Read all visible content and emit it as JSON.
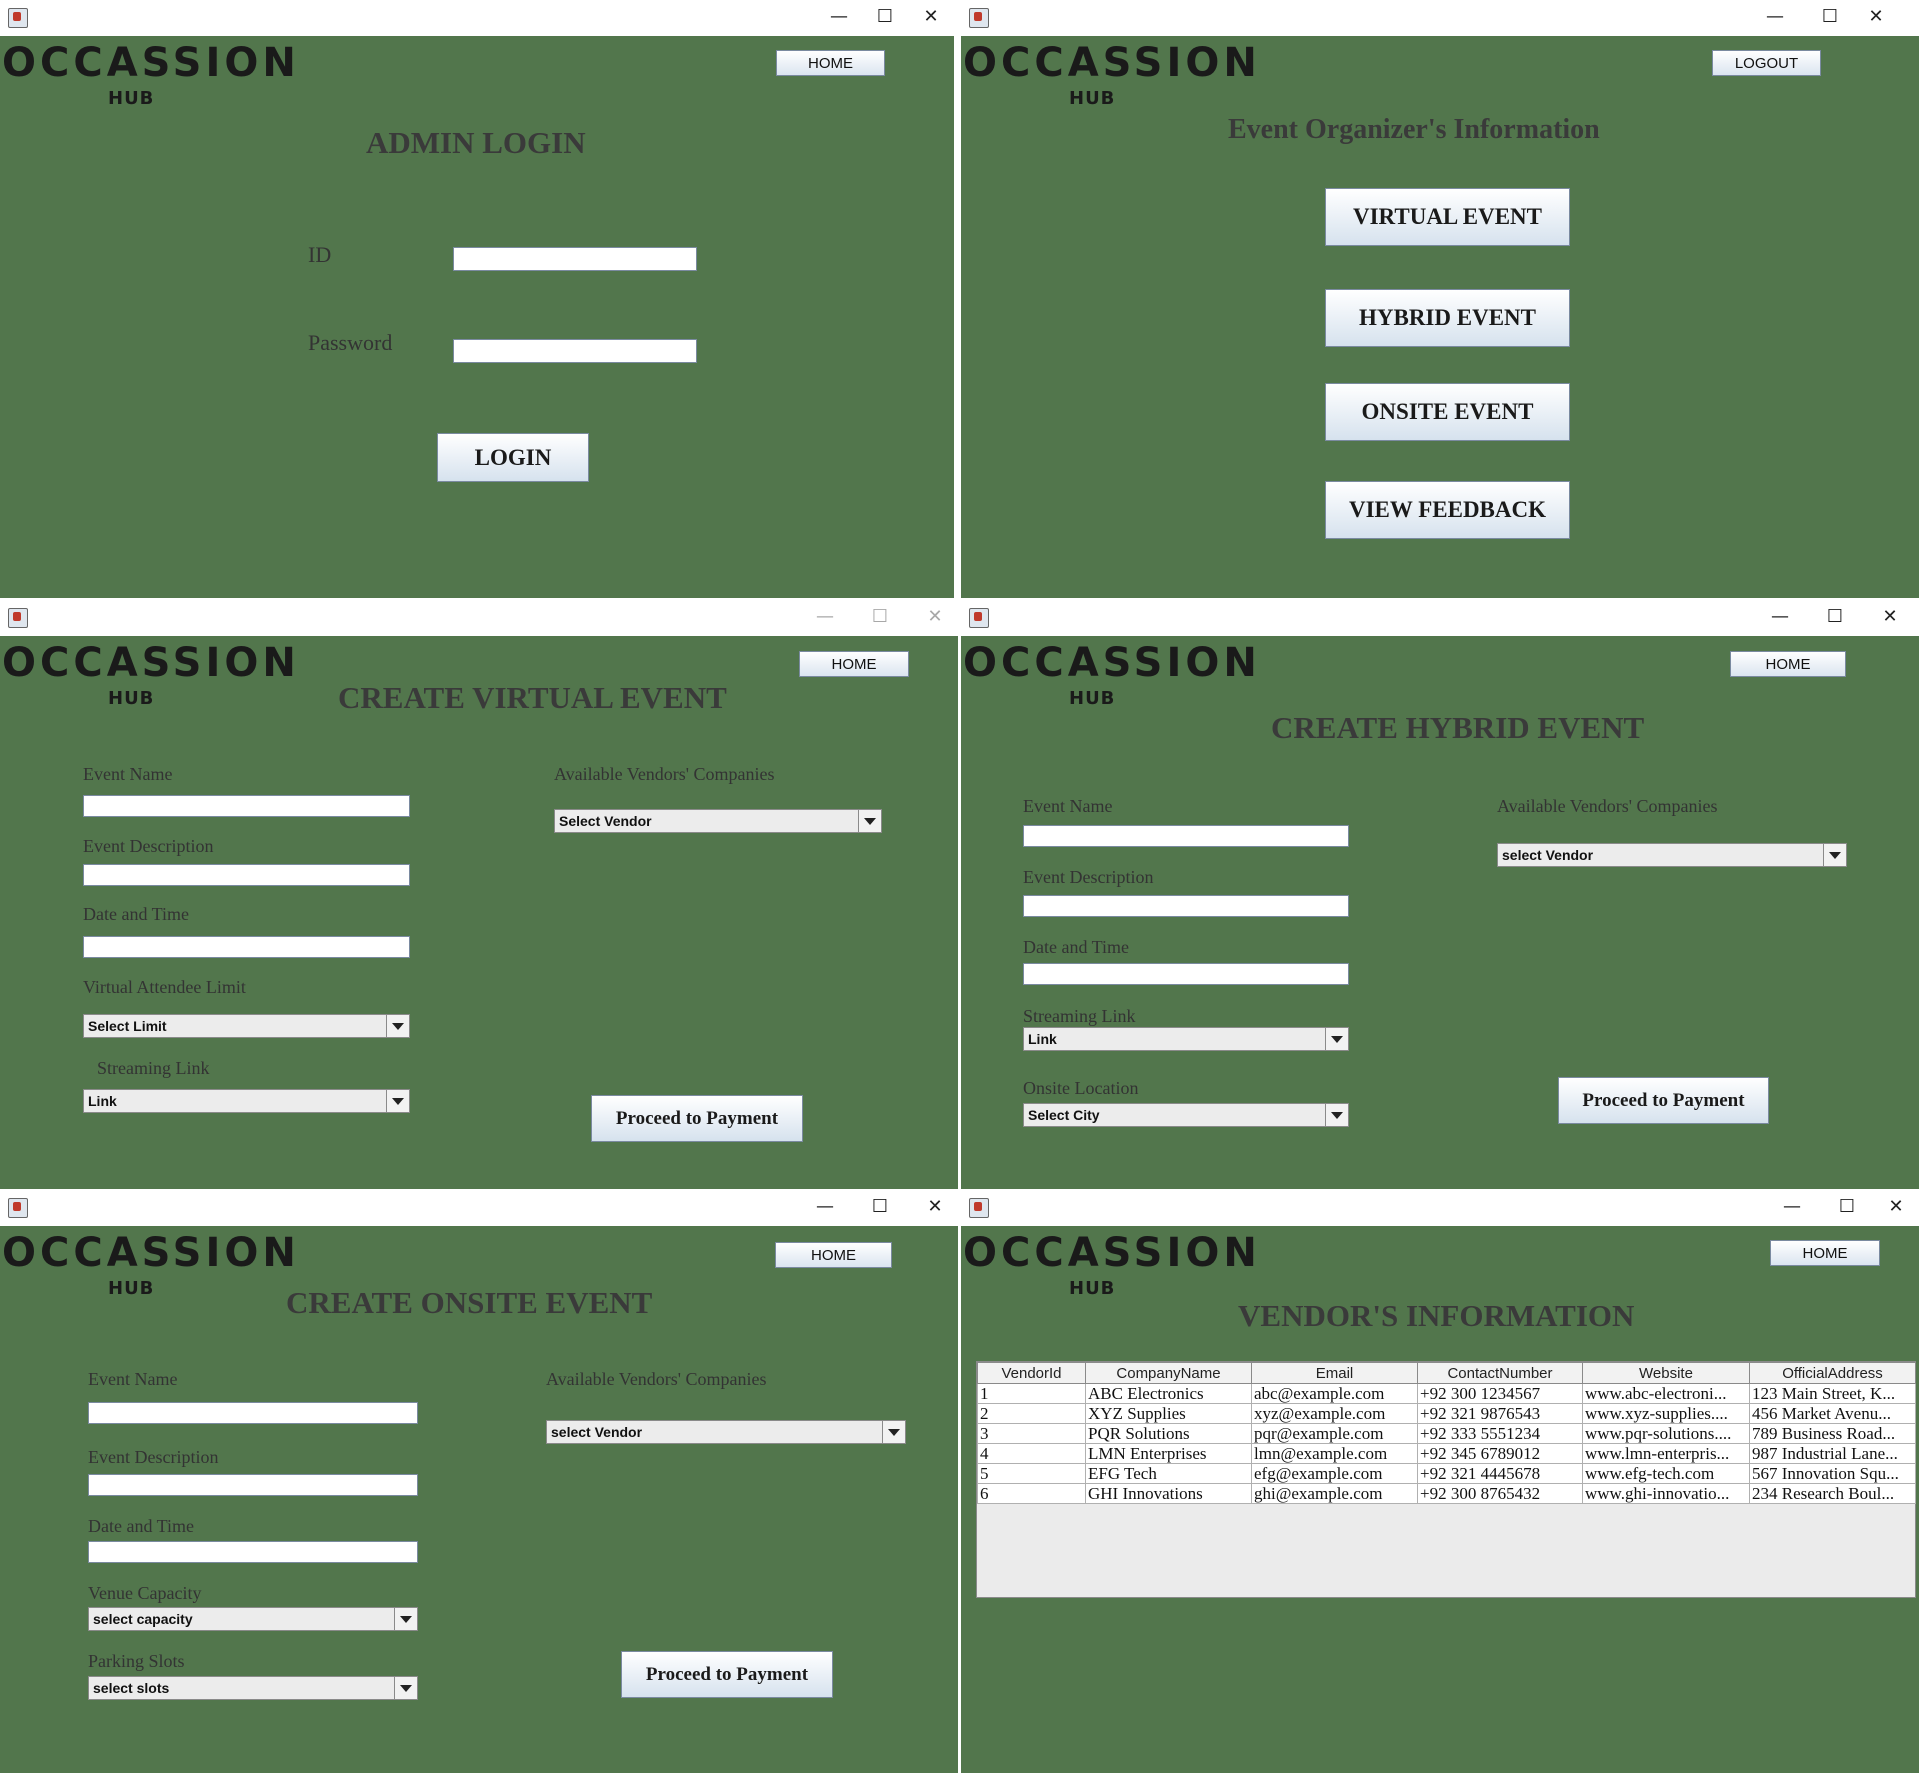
{
  "logo": {
    "word": "OCCASSION",
    "sub": "HUB"
  },
  "window_controls": {
    "minimize": "—",
    "maximize": "☐",
    "close": "✕"
  },
  "admin_login": {
    "home_button": "HOME",
    "title": "ADMIN LOGIN",
    "id_label": "ID",
    "password_label": "Password",
    "login_button": "LOGIN"
  },
  "organizer": {
    "logout_button": "LOGOUT",
    "title": "Event Organizer's Information",
    "buttons": [
      "VIRTUAL EVENT",
      "HYBRID EVENT",
      "ONSITE EVENT",
      "VIEW FEEDBACK"
    ]
  },
  "virtual_event": {
    "home_button": "HOME",
    "title": "CREATE VIRTUAL EVENT",
    "event_name_label": "Event Name",
    "event_description_label": "Event Description",
    "date_time_label": "Date and Time",
    "attendee_limit_label": "Virtual Attendee Limit",
    "attendee_limit_value": "Select Limit",
    "streaming_link_label": "Streaming Link",
    "streaming_link_value": "Link",
    "vendors_label": "Available Vendors' Companies",
    "vendor_value": "Select Vendor",
    "proceed_button": "Proceed to Payment"
  },
  "hybrid_event": {
    "home_button": "HOME",
    "title": "CREATE HYBRID EVENT",
    "event_name_label": "Event Name",
    "event_description_label": "Event Description",
    "date_time_label": "Date and Time",
    "streaming_link_label": "Streaming Link",
    "streaming_link_value": "Link",
    "onsite_location_label": "Onsite Location",
    "onsite_location_value": "Select City",
    "vendors_label": "Available Vendors' Companies",
    "vendor_value": "select Vendor",
    "proceed_button": "Proceed to Payment"
  },
  "onsite_event": {
    "home_button": "HOME",
    "title": "CREATE ONSITE EVENT",
    "event_name_label": "Event Name",
    "event_description_label": "Event Description",
    "date_time_label": "Date and Time",
    "venue_capacity_label": "Venue Capacity",
    "venue_capacity_value": "select capacity",
    "parking_slots_label": "Parking Slots",
    "parking_slots_value": "select slots",
    "vendors_label": "Available Vendors' Companies",
    "vendor_value": "select Vendor",
    "proceed_button": "Proceed to Payment"
  },
  "vendors": {
    "home_button": "HOME",
    "title": "VENDOR'S INFORMATION",
    "columns": [
      "VendorId",
      "CompanyName",
      "Email",
      "ContactNumber",
      "Website",
      "OfficialAddress"
    ],
    "rows": [
      [
        "1",
        "ABC Electronics",
        "abc@example.com",
        "+92 300 1234567",
        "www.abc-electroni...",
        "123 Main Street, K..."
      ],
      [
        "2",
        "XYZ Supplies",
        "xyz@example.com",
        "+92 321 9876543",
        "www.xyz-supplies....",
        "456 Market Avenu..."
      ],
      [
        "3",
        "PQR Solutions",
        "pqr@example.com",
        "+92 333 5551234",
        "www.pqr-solutions....",
        "789 Business Road..."
      ],
      [
        "4",
        "LMN Enterprises",
        "lmn@example.com",
        "+92 345 6789012",
        "www.lmn-enterpris...",
        "987 Industrial Lane..."
      ],
      [
        "5",
        "EFG Tech",
        "efg@example.com",
        "+92 321 4445678",
        "www.efg-tech.com",
        "567 Innovation Squ..."
      ],
      [
        "6",
        "GHI Innovations",
        "ghi@example.com",
        "+92 300 8765432",
        "www.ghi-innovatio...",
        "234 Research Boul..."
      ]
    ]
  }
}
